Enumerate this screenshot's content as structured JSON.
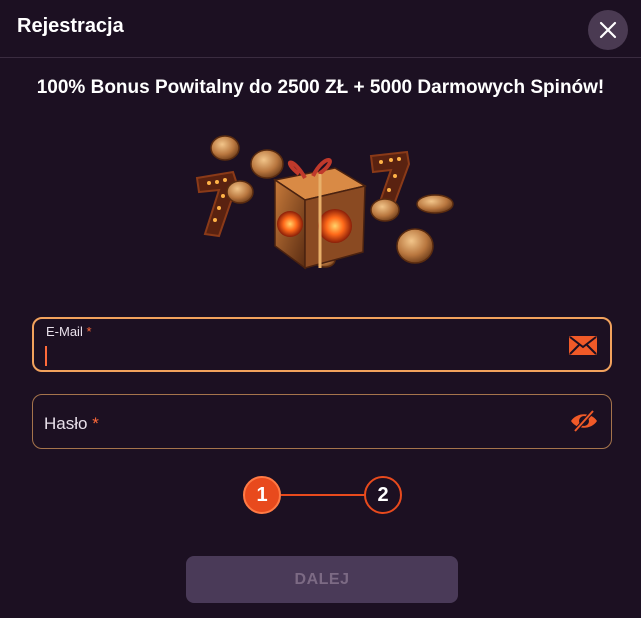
{
  "modal": {
    "title": "Rejestracja",
    "close_icon": "close-icon"
  },
  "promo": {
    "text": "100% Bonus Powitalny do 2500 ZŁ + 5000 Darmowych Spinów!"
  },
  "hero": {
    "image": "gift-box-with-coins-and-sevens"
  },
  "form": {
    "email": {
      "label": "E-Mail",
      "required_mark": "*",
      "value": "",
      "icon": "envelope-icon"
    },
    "password": {
      "label": "Hasło",
      "required_mark": "*",
      "value": "",
      "icon": "eye-hidden-icon"
    }
  },
  "stepper": {
    "steps": [
      "1",
      "2"
    ],
    "active_step": 1
  },
  "actions": {
    "next_label": "DALEJ"
  },
  "colors": {
    "background": "#1c1022",
    "accent": "#e84a1d",
    "field_border_active": "#f2a25d",
    "button_disabled": "#4a3a58"
  }
}
